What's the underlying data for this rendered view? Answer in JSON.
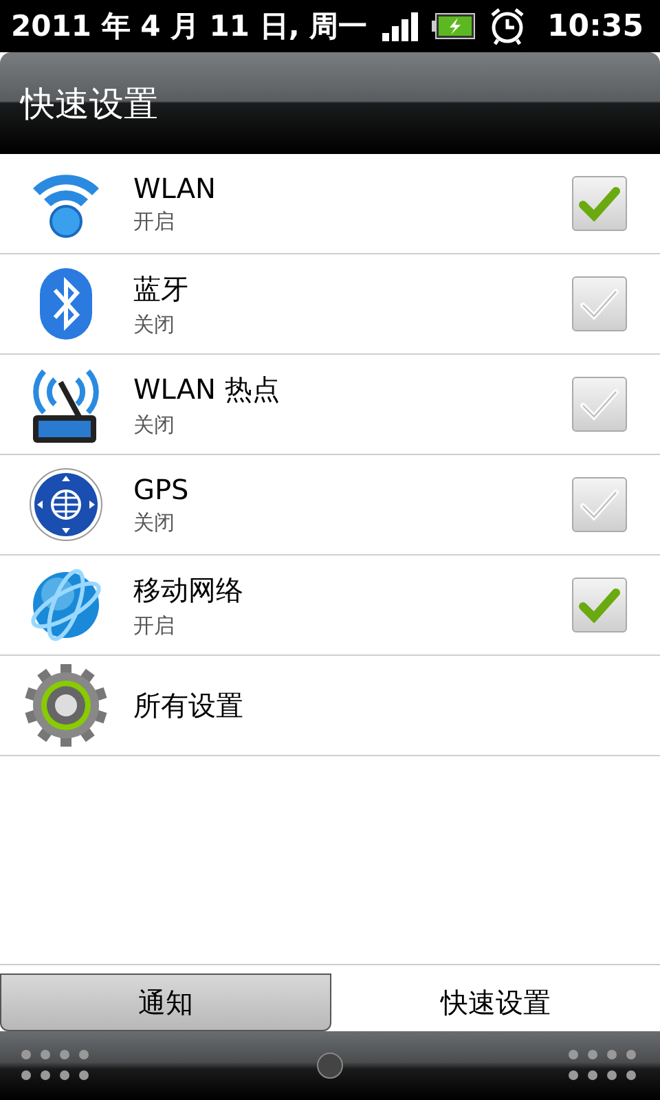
{
  "status_bar": {
    "date": "2011 年 4 月 11 日, 周一",
    "time": "10:35"
  },
  "title": "快速设置",
  "items": [
    {
      "kind": "toggle",
      "label": "WLAN",
      "status": "开启",
      "checked": true
    },
    {
      "kind": "toggle",
      "label": "蓝牙",
      "status": "关闭",
      "checked": false
    },
    {
      "kind": "toggle",
      "label": "WLAN 热点",
      "status": "关闭",
      "checked": false
    },
    {
      "kind": "toggle",
      "label": "GPS",
      "status": "关闭",
      "checked": false
    },
    {
      "kind": "toggle",
      "label": "移动网络",
      "status": "开启",
      "checked": true
    },
    {
      "kind": "link",
      "label": "所有设置"
    }
  ],
  "tabs": [
    {
      "label": "通知",
      "selected": false
    },
    {
      "label": "快速设置",
      "selected": true
    }
  ]
}
